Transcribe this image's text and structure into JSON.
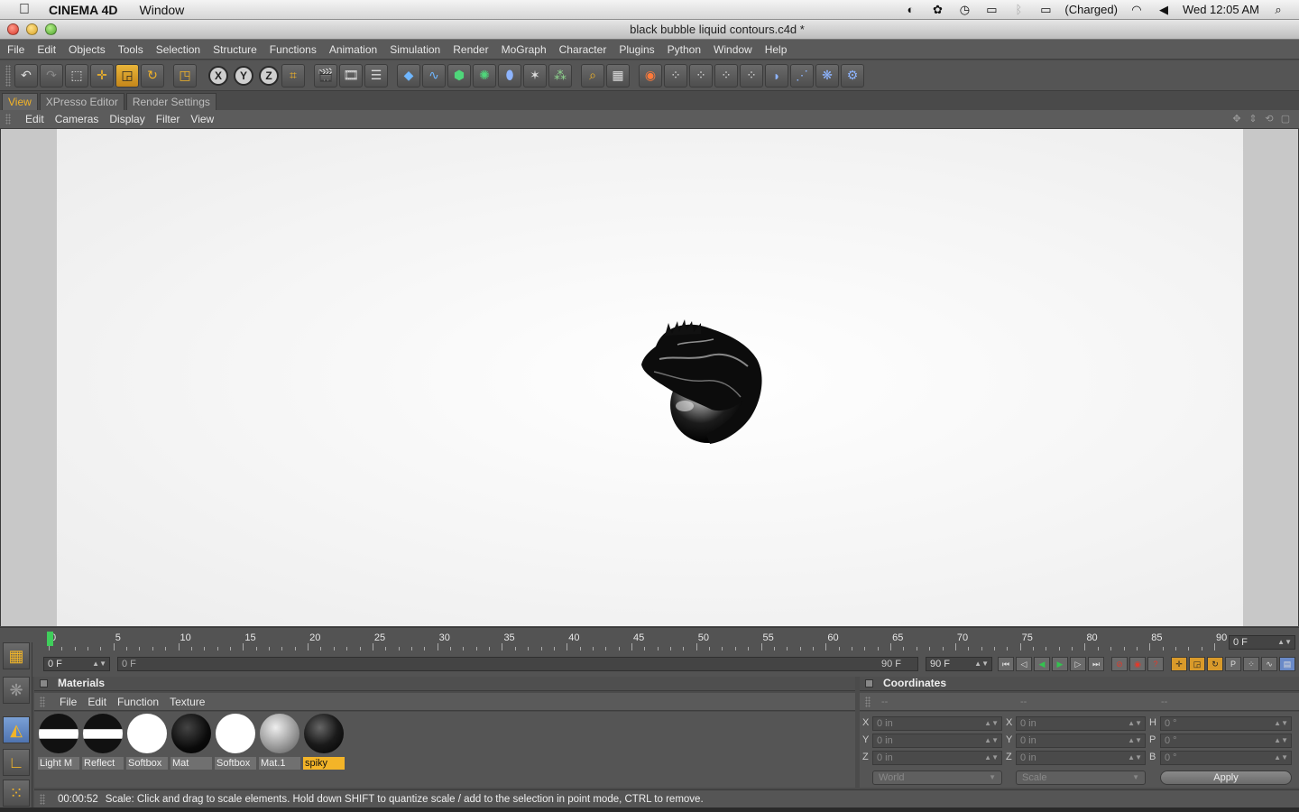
{
  "mac_menubar": {
    "app_name": "CINEMA 4D",
    "menu": [
      "Window"
    ],
    "battery": "(Charged)",
    "clock": "Wed 12:05 AM"
  },
  "window": {
    "title": "black bubble liquid contours.c4d *"
  },
  "app_menu": [
    "File",
    "Edit",
    "Objects",
    "Tools",
    "Selection",
    "Structure",
    "Functions",
    "Animation",
    "Simulation",
    "Render",
    "MoGraph",
    "Character",
    "Plugins",
    "Python",
    "Window",
    "Help"
  ],
  "toolbar": {
    "axis_labels": [
      "X",
      "Y",
      "Z"
    ]
  },
  "tabs": [
    "View",
    "XPresso Editor",
    "Render Settings"
  ],
  "view_menu": [
    "Edit",
    "Cameras",
    "Display",
    "Filter",
    "View"
  ],
  "timeline": {
    "ruler_labels": [
      "0",
      "5",
      "10",
      "15",
      "20",
      "25",
      "30",
      "35",
      "40",
      "45",
      "50",
      "55",
      "60",
      "65",
      "70",
      "75",
      "80",
      "85",
      "90"
    ],
    "current_frame_right": "0 F",
    "start_frame": "0 F",
    "scrub_left": "0 F",
    "scrub_right": "90 F",
    "end_frame": "90 F"
  },
  "materials": {
    "title": "Materials",
    "menu": [
      "File",
      "Edit",
      "Function",
      "Texture"
    ],
    "items": [
      "Light M",
      "Reflect",
      "Softbox",
      "Mat",
      "Softbox",
      "Mat.1",
      "spiky"
    ],
    "selected": "spiky"
  },
  "coordinates": {
    "title": "Coordinates",
    "headers": [
      "--",
      "--",
      "--"
    ],
    "rows": [
      {
        "pos_label": "X",
        "pos": "0 in",
        "size_label": "X",
        "size": "0 in",
        "rot_label": "H",
        "rot": "0 °"
      },
      {
        "pos_label": "Y",
        "pos": "0 in",
        "size_label": "Y",
        "size": "0 in",
        "rot_label": "P",
        "rot": "0 °"
      },
      {
        "pos_label": "Z",
        "pos": "0 in",
        "size_label": "Z",
        "size": "0 in",
        "rot_label": "B",
        "rot": "0 °"
      }
    ],
    "space_dropdown": "World",
    "mode_dropdown": "Scale",
    "apply_label": "Apply"
  },
  "status": {
    "time": "00:00:52",
    "message": "Scale: Click and drag to scale elements. Hold down SHIFT to quantize scale / add to the selection in point mode, CTRL to remove."
  },
  "colors": {
    "accent": "#f3b428",
    "playhead": "#3fce5b"
  }
}
